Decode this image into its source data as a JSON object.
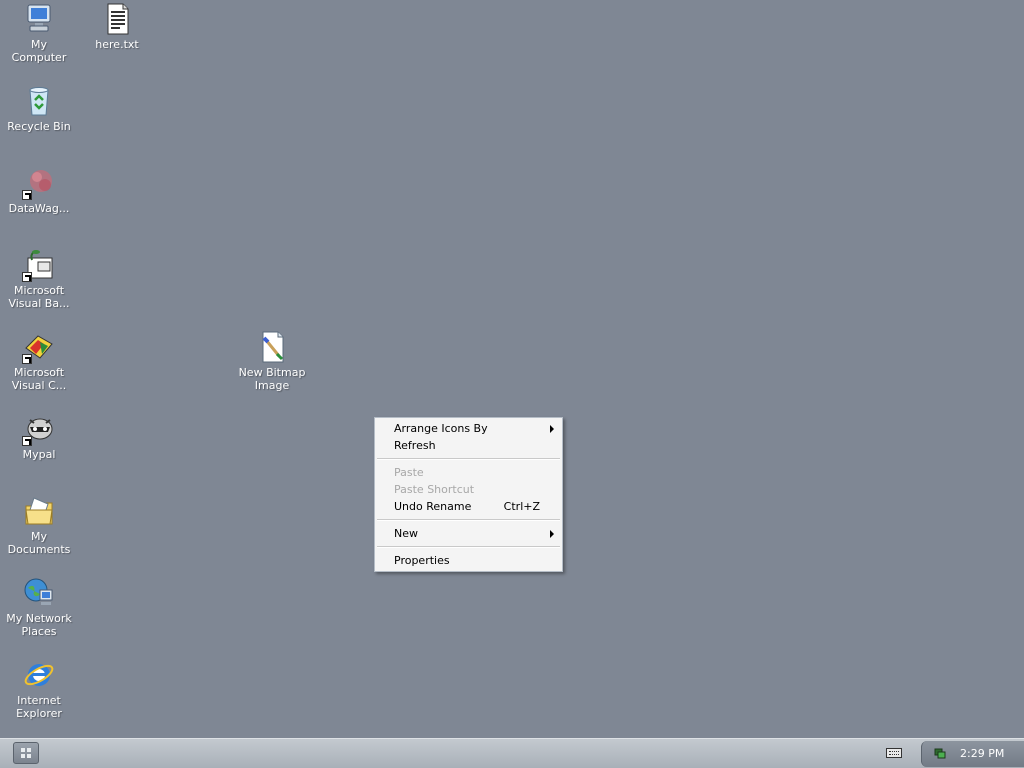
{
  "desktop": {
    "background_color": "#7f8794",
    "icons": [
      {
        "label": "My\nComputer",
        "icon": "my-computer-icon"
      },
      {
        "label": "here.txt",
        "icon": "text-file-icon"
      },
      {
        "label": "Recycle Bin",
        "icon": "recycle-bin-icon"
      },
      {
        "label": "DataWag...",
        "icon": "datawag-shortcut-icon"
      },
      {
        "label": "Microsoft\nVisual Ba...",
        "icon": "visual-basic-shortcut-icon"
      },
      {
        "label": "Microsoft\nVisual C...",
        "icon": "visual-c-shortcut-icon"
      },
      {
        "label": "New Bitmap\nImage",
        "icon": "bitmap-image-icon"
      },
      {
        "label": "Mypal",
        "icon": "mypal-shortcut-icon"
      },
      {
        "label": "My\nDocuments",
        "icon": "my-documents-icon"
      },
      {
        "label": "My Network\nPlaces",
        "icon": "network-places-icon"
      },
      {
        "label": "Internet\nExplorer",
        "icon": "internet-explorer-icon"
      }
    ]
  },
  "context_menu": {
    "items": [
      {
        "label": "Arrange Icons By",
        "enabled": true,
        "submenu": true
      },
      {
        "label": "Refresh",
        "enabled": true
      },
      {
        "label": "Paste",
        "enabled": false
      },
      {
        "label": "Paste Shortcut",
        "enabled": false
      },
      {
        "label": "Undo Rename",
        "enabled": true,
        "shortcut": "Ctrl+Z"
      },
      {
        "label": "New",
        "enabled": true,
        "submenu": true
      },
      {
        "label": "Properties",
        "enabled": true
      }
    ]
  },
  "taskbar": {
    "start_icon": "start-grid-icon",
    "tray_icons": [
      "keyboard-icon",
      "network-icon"
    ],
    "clock": "2:29 PM"
  }
}
